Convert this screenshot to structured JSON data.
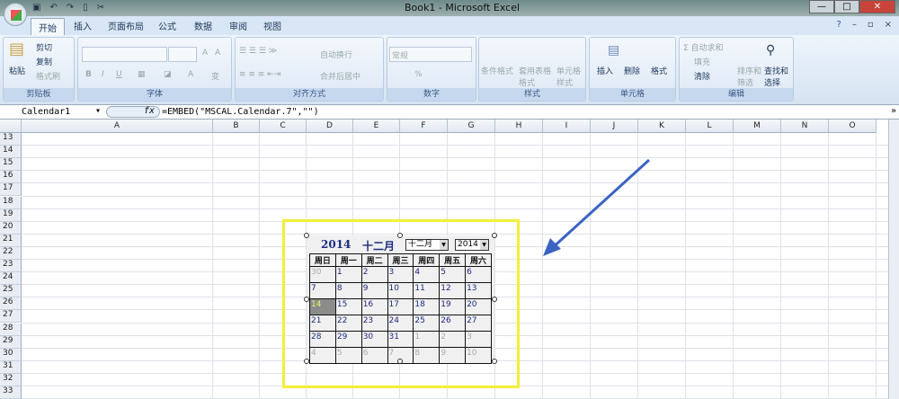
{
  "window": {
    "title": "Book1 - Microsoft Excel",
    "minimize": "—",
    "maximize": "□",
    "close": "✕"
  },
  "qat": [
    "save-icon",
    "undo-icon",
    "redo-icon",
    "new-icon",
    "tools-icon"
  ],
  "tabs": [
    "开始",
    "插入",
    "页面布局",
    "公式",
    "数据",
    "审阅",
    "视图"
  ],
  "ribbon": {
    "clipboard": {
      "paste": "粘贴",
      "cut": "剪切",
      "copy": "复制",
      "format_painter": "格式刷",
      "label": "剪贴板"
    },
    "font": {
      "label": "字体",
      "bold": "B",
      "italic": "I",
      "underline": "U",
      "grow": "A",
      "shrink": "A",
      "color": "A",
      "phonetic": "变"
    },
    "alignment": {
      "wrap": "自动换行",
      "merge": "合并后居中",
      "label": "对齐方式"
    },
    "number": {
      "format": "常规",
      "percent": "%",
      "label": "数字"
    },
    "styles": {
      "conditional": "条件格式",
      "table": "套用表格格式",
      "cell": "单元格样式",
      "label": "样式"
    },
    "cells": {
      "insert": "插入",
      "delete": "删除",
      "format": "格式",
      "label": "单元格"
    },
    "editing": {
      "autosum": "Σ 自动求和",
      "fill": "填充",
      "clear": "清除",
      "sort": "排序和筛选",
      "find": "查找和选择",
      "label": "编辑"
    }
  },
  "formula_bar": {
    "name_box": "Calendar1",
    "fx": "fx",
    "formula": "=EMBED(\"MSCAL.Calendar.7\",\"\")"
  },
  "columns": [
    "A",
    "B",
    "C",
    "D",
    "E",
    "F",
    "G",
    "H",
    "I",
    "J",
    "K",
    "L",
    "M",
    "N",
    "O"
  ],
  "rows": [
    "13",
    "14",
    "15",
    "16",
    "17",
    "18",
    "19",
    "20",
    "21",
    "22",
    "23",
    "24",
    "25",
    "26",
    "27",
    "28",
    "29",
    "30",
    "31",
    "32",
    "33"
  ],
  "calendar": {
    "year": "2014",
    "month": "十二月",
    "month_select": "十二月",
    "year_select": "2014",
    "weekdays": [
      "周日",
      "周一",
      "周二",
      "周三",
      "周四",
      "周五",
      "周六"
    ],
    "weeks": [
      [
        "30",
        "1",
        "2",
        "3",
        "4",
        "5",
        "6"
      ],
      [
        "7",
        "8",
        "9",
        "10",
        "11",
        "12",
        "13"
      ],
      [
        "14",
        "15",
        "16",
        "17",
        "18",
        "19",
        "20"
      ],
      [
        "21",
        "22",
        "23",
        "24",
        "25",
        "26",
        "27"
      ],
      [
        "28",
        "29",
        "30",
        "31",
        "1",
        "2",
        "3"
      ],
      [
        "4",
        "5",
        "6",
        "7",
        "8",
        "9",
        "10"
      ]
    ],
    "selected": "14"
  },
  "colors": {
    "highlight": "#f5ee3a",
    "arrow": "#3b63c4"
  }
}
